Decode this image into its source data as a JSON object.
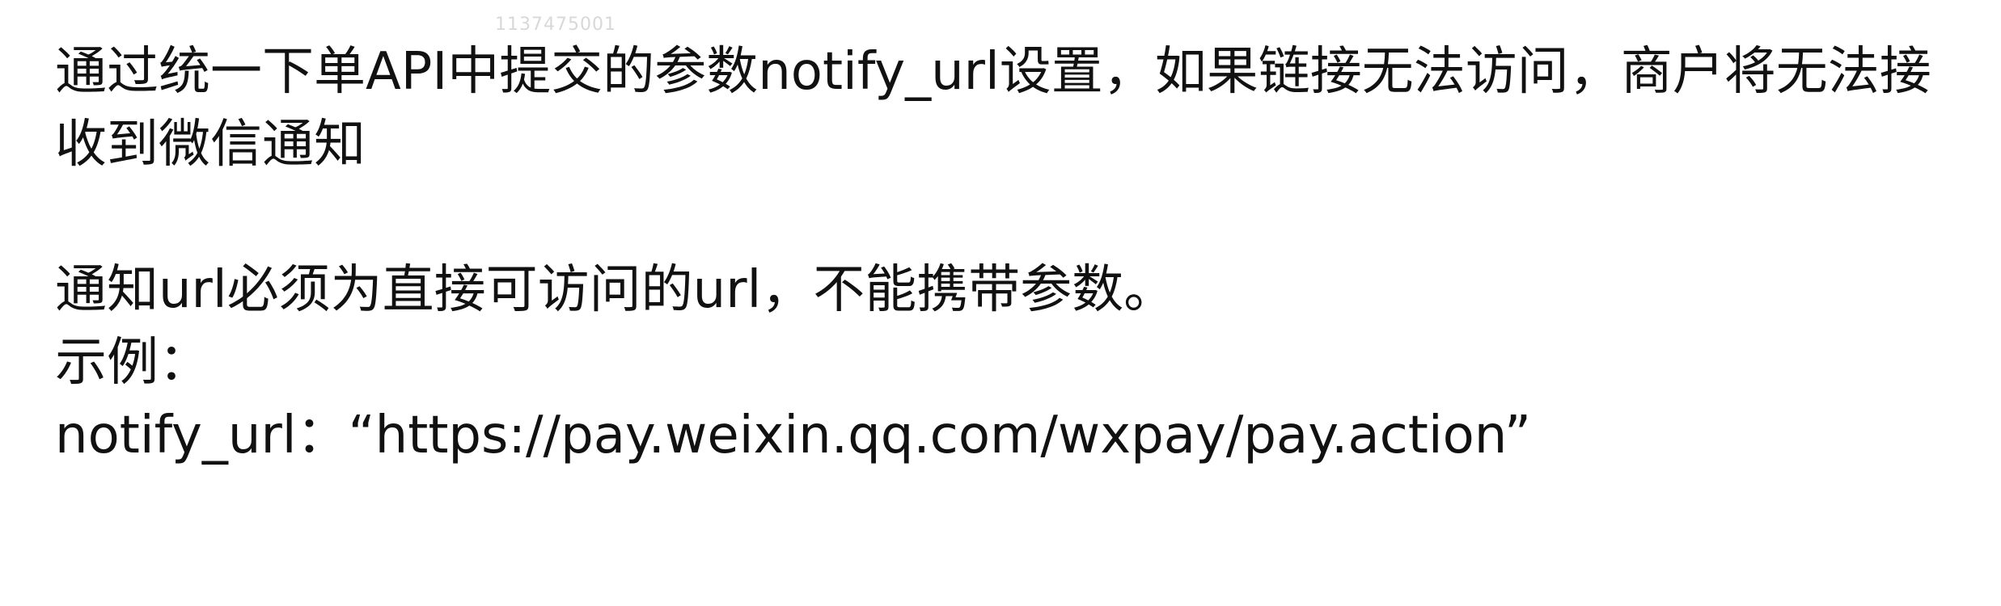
{
  "watermark": "1137475001",
  "doc": {
    "para1": "通过统一下单API中提交的参数notify_url设置，如果链接无法访问，商户将无法接收到微信通知",
    "para2": "通知url必须为直接可访问的url，不能携带参数。",
    "para3": "示例：",
    "para4": "notify_url：“https://pay.weixin.qq.com/wxpay/pay.action”"
  }
}
